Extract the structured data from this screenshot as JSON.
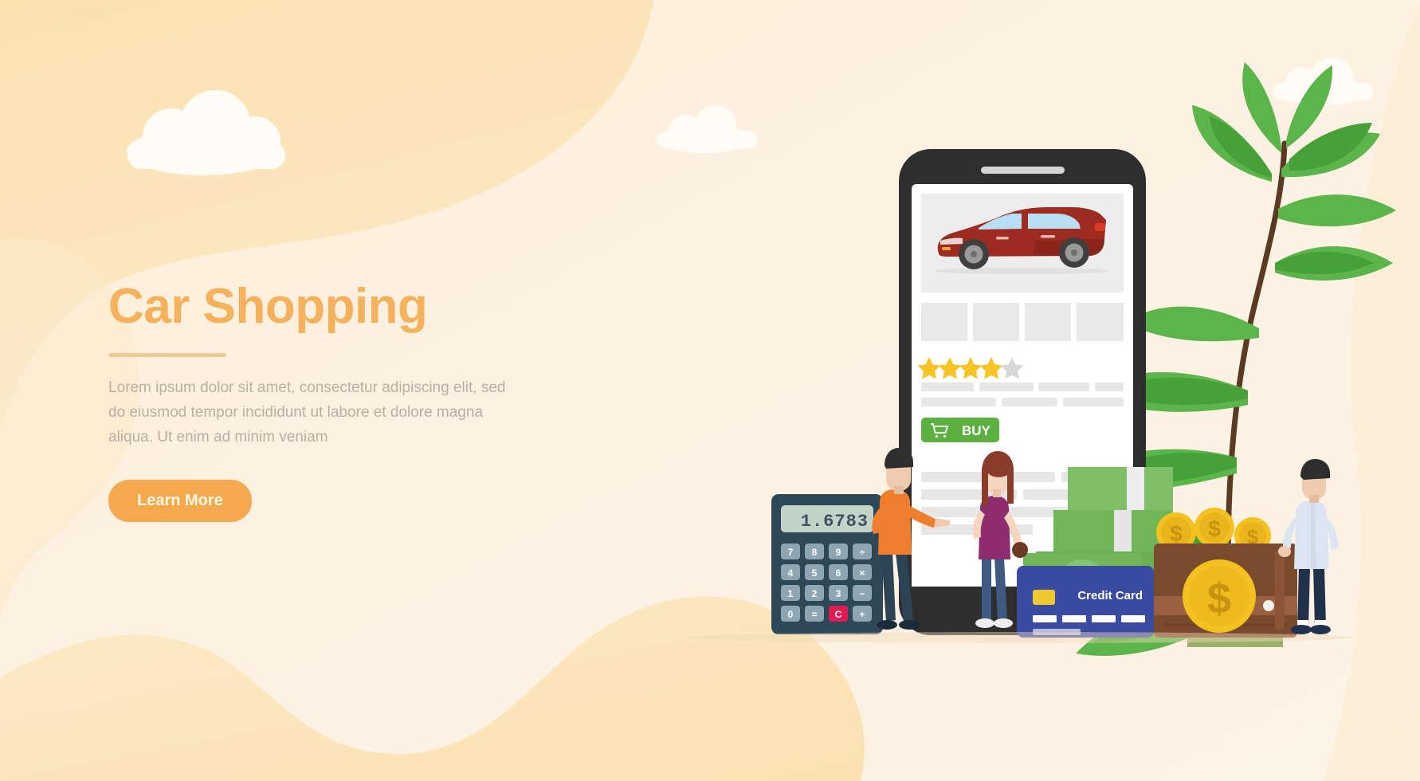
{
  "page": {
    "title": "Car Shopping",
    "background_color": "#FDF1E0",
    "blob_color": "#FBE3B9",
    "cloud_color": "#FFFCF6"
  },
  "hero": {
    "title": "Car Shopping",
    "title_color": "#F5B15C",
    "divider_color": "#EBCB96",
    "body_text": "Lorem ipsum dolor sit amet, consectetur adipiscing elit, sed do eiusmod tempor incididunt ut labore et dolore magna aliqua. Ut enim ad minim veniam",
    "body_color": "#B9AFA4",
    "cta_label": "Learn More",
    "cta_bg": "#F5A94E",
    "cta_text_color": "#FFF6E4"
  },
  "phone": {
    "frame_color": "#2E2E2E",
    "screen_color": "#FFFFFF",
    "speaker_color": "#D4D4D4",
    "product_image_bg": "#EDEDED",
    "car": {
      "body_color": "#9E2B20",
      "body_shadow": "#7E1F17",
      "window_color": "#B9DFF5",
      "wheel_color": "#4A4A4A",
      "hub_color": "#9A9A9A"
    },
    "thumbnails": [
      "thumb-1",
      "thumb-2",
      "thumb-3",
      "thumb-4"
    ],
    "thumbnail_color": "#E9E9E9",
    "rating": {
      "value": 4,
      "max": 5,
      "filled_color": "#F7C325",
      "empty_color": "#D8D8D8"
    },
    "placeholder_rows": [
      [
        118,
        122,
        116,
        102
      ],
      [
        160,
        125,
        160
      ]
    ],
    "placeholder_color": "#E7E7E7",
    "buy_button": {
      "label": "BUY",
      "bg": "#5BB03F",
      "text_color": "#FFFFFF",
      "icon": "shopping-cart-icon"
    }
  },
  "calculator": {
    "body_color": "#2F4858",
    "display_value": "1.6783",
    "display_bg": "#C2D3C8",
    "display_text_color": "#3C5260",
    "key_color": "#8FA5B2",
    "key_text_color": "#FFFFFF",
    "clear_key_color": "#E31B54",
    "keys": [
      [
        "7",
        "8",
        "9",
        "÷"
      ],
      [
        "4",
        "5",
        "6",
        "×"
      ],
      [
        "1",
        "2",
        "3",
        "−"
      ],
      [
        "0",
        "=",
        "C",
        "+"
      ]
    ]
  },
  "credit_card": {
    "label": "Credit Card",
    "bg": "#3A4BA0",
    "chip_color": "#EFC731",
    "text_color": "#FFFFFF",
    "stripe_color": "#FFFFFF"
  },
  "money": {
    "bill_color": "#72B65A",
    "bill_dark": "#5FA449",
    "bill_light": "#8CC876",
    "dollar_symbol": "$",
    "dollar_color": "#FFFFFF",
    "coin_color": "#F4C220",
    "coin_edge": "#E0A81B",
    "coin_symbol": "$"
  },
  "wallet": {
    "body_color": "#7A4A2E",
    "flap_color": "#9A6140",
    "strap_color": "#8A5436"
  },
  "plant": {
    "leaf_color": "#5CB54A",
    "leaf_dark": "#48A038",
    "stem_color": "#5A3A22",
    "pot_color": "#9BB06A"
  },
  "people": [
    {
      "name": "man-pointing",
      "shirt_color": "#EE7E2D",
      "pants_color": "#2D4356",
      "skin_color": "#F0CBB0",
      "hair_color": "#2E2E2E"
    },
    {
      "name": "woman-shopper",
      "shirt_color": "#8E2D6E",
      "pants_color": "#3F5A80",
      "skin_color": "#F5D5BD",
      "hair_color": "#8A3B2A"
    },
    {
      "name": "man-standing",
      "shirt_color": "#DCE6F2",
      "pants_color": "#20324B",
      "skin_color": "#F0CBB0",
      "hair_color": "#2E2E2E"
    }
  ]
}
